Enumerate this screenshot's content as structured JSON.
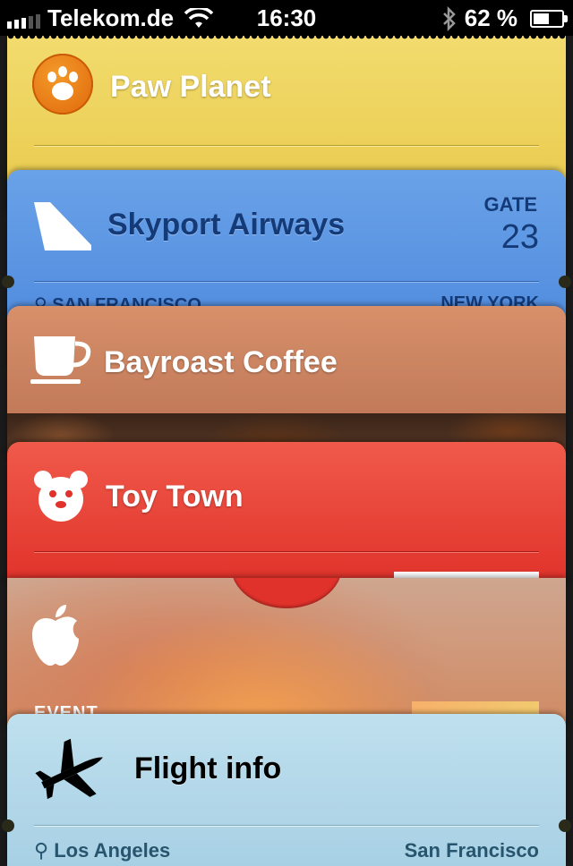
{
  "status_bar": {
    "carrier": "Telekom.de",
    "time": "16:30",
    "battery": "62 %",
    "battery_level": 0.62
  },
  "passes": {
    "paw_planet": {
      "title": "Paw Planet",
      "icon": "paw-icon",
      "color": "#e8c84a"
    },
    "skyport": {
      "title": "Skyport Airways",
      "icon": "airplane-tail-icon",
      "gate_label": "GATE",
      "gate_value": "23",
      "from": "SAN FRANCISCO",
      "to": "NEW YORK",
      "color": "#4a86db"
    },
    "bayroast": {
      "title": "Bayroast Coffee",
      "icon": "coffee-cup-icon",
      "color": "#b97152"
    },
    "toy_town": {
      "title": "Toy Town",
      "icon": "bear-icon",
      "color": "#e0322a"
    },
    "event": {
      "label": "EVENT",
      "icon": "apple-logo-icon"
    },
    "flight_info": {
      "title": "Flight info",
      "icon": "airplane-icon",
      "from": "Los Angeles",
      "to": "San Francisco",
      "color": "#a8d0e4"
    }
  }
}
